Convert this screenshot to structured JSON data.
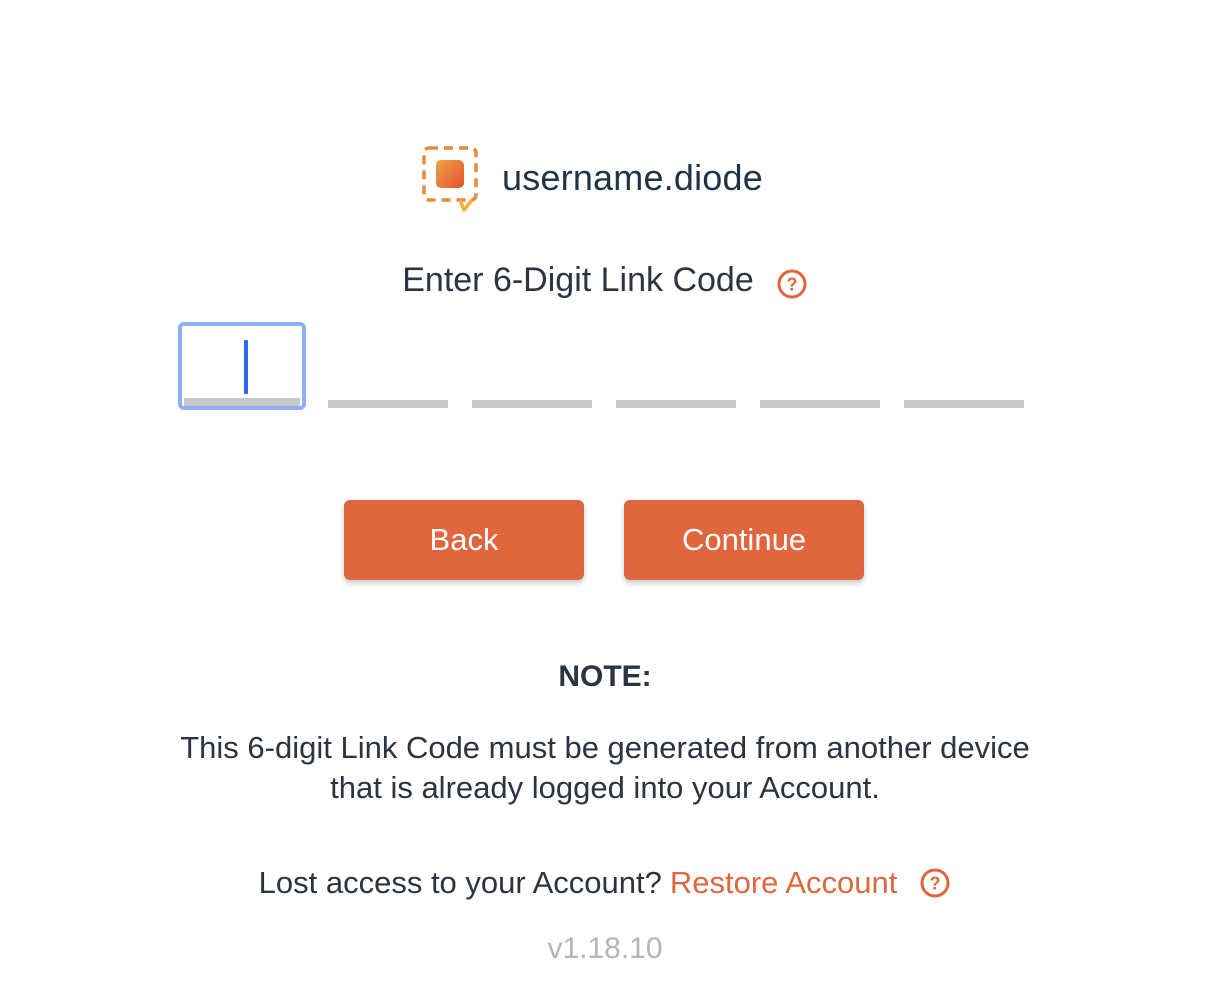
{
  "brand": {
    "name": "username.diode",
    "logo_icon": "diode-chat-logo-icon"
  },
  "colors": {
    "accent": "#e0663e",
    "text": "#2b3440",
    "brand_text": "#1f3346",
    "focus_border": "#8fb0f3",
    "caret": "#2a6de8",
    "muted": "#b5b5b5"
  },
  "link_code": {
    "title": "Enter 6-Digit Link Code",
    "help_icon": "question-circle-icon",
    "digits": [
      "",
      "",
      "",
      "",
      "",
      ""
    ]
  },
  "buttons": {
    "back_label": "Back",
    "continue_label": "Continue"
  },
  "note": {
    "heading": "NOTE:",
    "line1": "This 6-digit Link Code must be generated from another device",
    "line2": "that is already logged into your Account."
  },
  "restore": {
    "prefix": "Lost access to your Account?",
    "link_label": "Restore Account",
    "help_icon": "question-circle-icon"
  },
  "version": "v1.18.10"
}
